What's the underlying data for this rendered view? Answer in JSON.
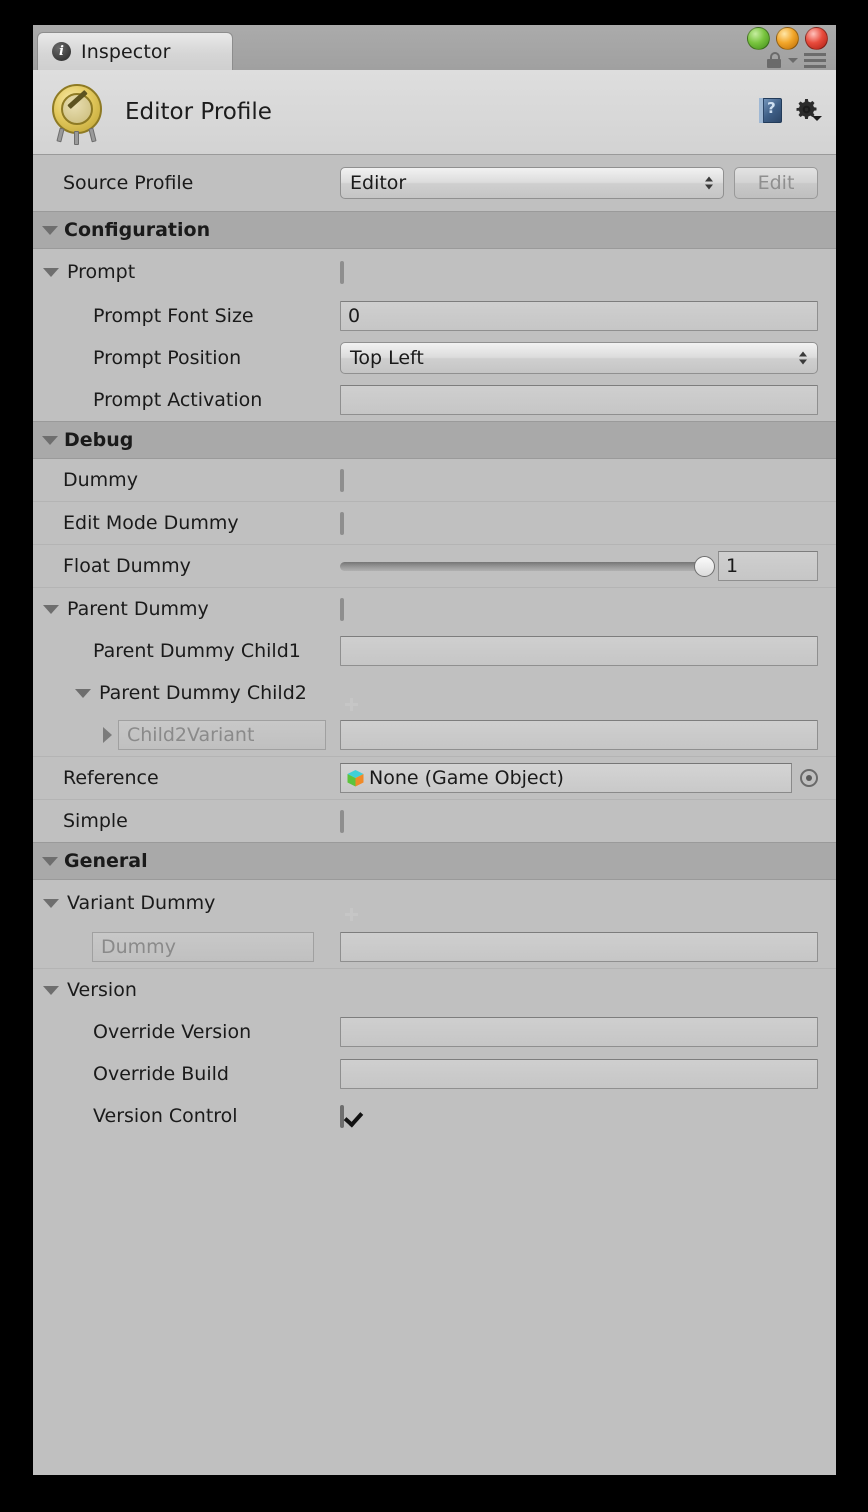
{
  "window": {
    "tab_label": "Inspector",
    "tab_icon": "info-icon",
    "traffic_lights": [
      "close-green",
      "minimize-orange",
      "zoom-red"
    ],
    "lock_icon": "lock-icon",
    "menu_icon": "hamburger-menu-icon"
  },
  "header": {
    "title": "Editor Profile",
    "object_icon": "editor-profile-icon",
    "help_icon": "help-book-icon",
    "settings_icon": "gear-icon"
  },
  "source_profile": {
    "label": "Source Profile",
    "value": "Editor",
    "edit_button": "Edit"
  },
  "sections": {
    "configuration": "Configuration",
    "debug": "Debug",
    "general": "General"
  },
  "configuration": {
    "prompt": {
      "label": "Prompt",
      "checked": false
    },
    "prompt_font_size": {
      "label": "Prompt Font Size",
      "value": "0"
    },
    "prompt_position": {
      "label": "Prompt Position",
      "value": "Top Left"
    },
    "prompt_activation": {
      "label": "Prompt Activation",
      "value": ""
    }
  },
  "debug": {
    "dummy": {
      "label": "Dummy",
      "checked": false
    },
    "edit_mode_dummy": {
      "label": "Edit Mode Dummy",
      "checked": false
    },
    "float_dummy": {
      "label": "Float Dummy",
      "value": "1",
      "slider_percent": 100
    },
    "parent_dummy": {
      "label": "Parent Dummy",
      "checked": false
    },
    "parent_dummy_child1": {
      "label": "Parent Dummy Child1",
      "value": ""
    },
    "parent_dummy_child2": {
      "label": "Parent Dummy Child2",
      "add_icon": "plus-icon"
    },
    "child2_variant": {
      "label": "Child2Variant",
      "value": ""
    },
    "reference": {
      "label": "Reference",
      "value": "None (Game Object)",
      "icon": "game-object-cube-icon",
      "picker": "target-picker-icon"
    },
    "simple": {
      "label": "Simple",
      "checked": false
    }
  },
  "general": {
    "variant_dummy": {
      "label": "Variant Dummy",
      "add_icon": "plus-icon"
    },
    "variant_dummy_entry": {
      "label": "Dummy",
      "value": ""
    },
    "version": {
      "label": "Version"
    },
    "override_version": {
      "label": "Override Version",
      "value": ""
    },
    "override_build": {
      "label": "Override Build",
      "value": ""
    },
    "version_control": {
      "label": "Version Control",
      "checked": true
    }
  },
  "colors": {
    "background": "#c0c0c0",
    "section_header": "#a9a9a9",
    "header_bar": "#d6d6d6",
    "checkbox_checked": "#8fb3d8"
  }
}
